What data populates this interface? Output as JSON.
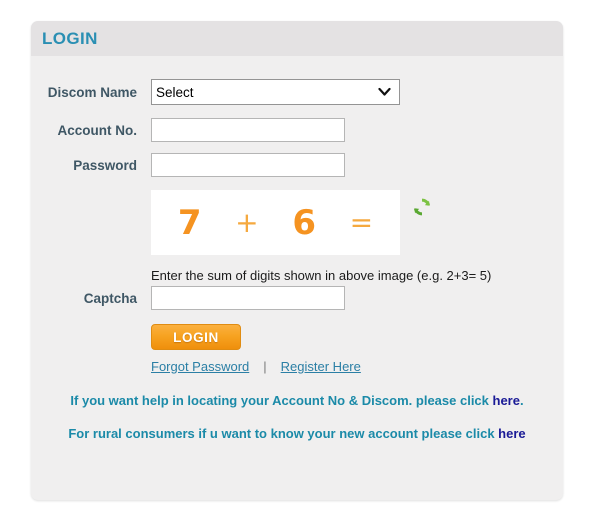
{
  "panel": {
    "title": "LOGIN"
  },
  "form": {
    "discom": {
      "label": "Discom Name",
      "selected": "Select",
      "options": [
        "Select"
      ]
    },
    "account": {
      "label": "Account No.",
      "value": "",
      "placeholder": ""
    },
    "password": {
      "label": "Password",
      "value": "",
      "placeholder": ""
    },
    "captcha": {
      "label": "Captcha",
      "value": "",
      "placeholder": "",
      "hint": "Enter the sum of digits shown in above image (e.g. 2+3= 5)",
      "image": {
        "first_digit": "7",
        "operator": "+",
        "second_digit": "6",
        "equals": "="
      },
      "refresh_icon": "refresh-icon"
    },
    "submit_label": "LOGIN"
  },
  "links": {
    "forgot_password": "Forgot Password",
    "separator": "|",
    "register_here": "Register Here"
  },
  "help": {
    "line1_text": "If you want help in locating your Account No & Discom. please click ",
    "line1_link": "here",
    "line1_suffix": ".",
    "line2_text": "For rural consumers if u want to know your new account please click ",
    "line2_link": "here",
    "line2_suffix": ""
  },
  "colors": {
    "title": "#2a8fb3",
    "label": "#3f5765",
    "captcha_text": "#f59321",
    "button": "#f7a321",
    "link": "#2b7fa5",
    "help_text": "#1b8aa8",
    "help_link": "#1a1a96",
    "refresh_icon": "#6cbe45"
  }
}
